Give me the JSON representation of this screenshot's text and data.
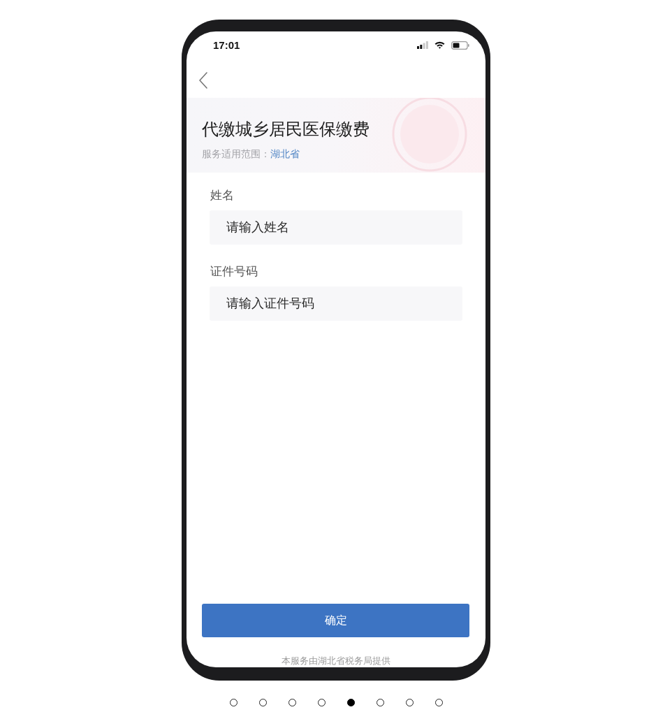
{
  "status_bar": {
    "time": "17:01"
  },
  "header": {
    "title": "代缴城乡居民医保缴费",
    "scope_label": "服务适用范围：",
    "scope_value": "湖北省"
  },
  "form": {
    "fields": [
      {
        "label": "姓名",
        "placeholder": "请输入姓名"
      },
      {
        "label": "证件号码",
        "placeholder": "请输入证件号码"
      }
    ]
  },
  "confirm_button": {
    "label": "确定"
  },
  "footer": "本服务由湖北省税务局提供",
  "pager": {
    "dots": [
      {
        "selected": false
      },
      {
        "selected": false
      },
      {
        "selected": false
      },
      {
        "selected": false
      },
      {
        "selected": true
      },
      {
        "selected": false
      },
      {
        "selected": false
      },
      {
        "selected": false
      }
    ]
  }
}
